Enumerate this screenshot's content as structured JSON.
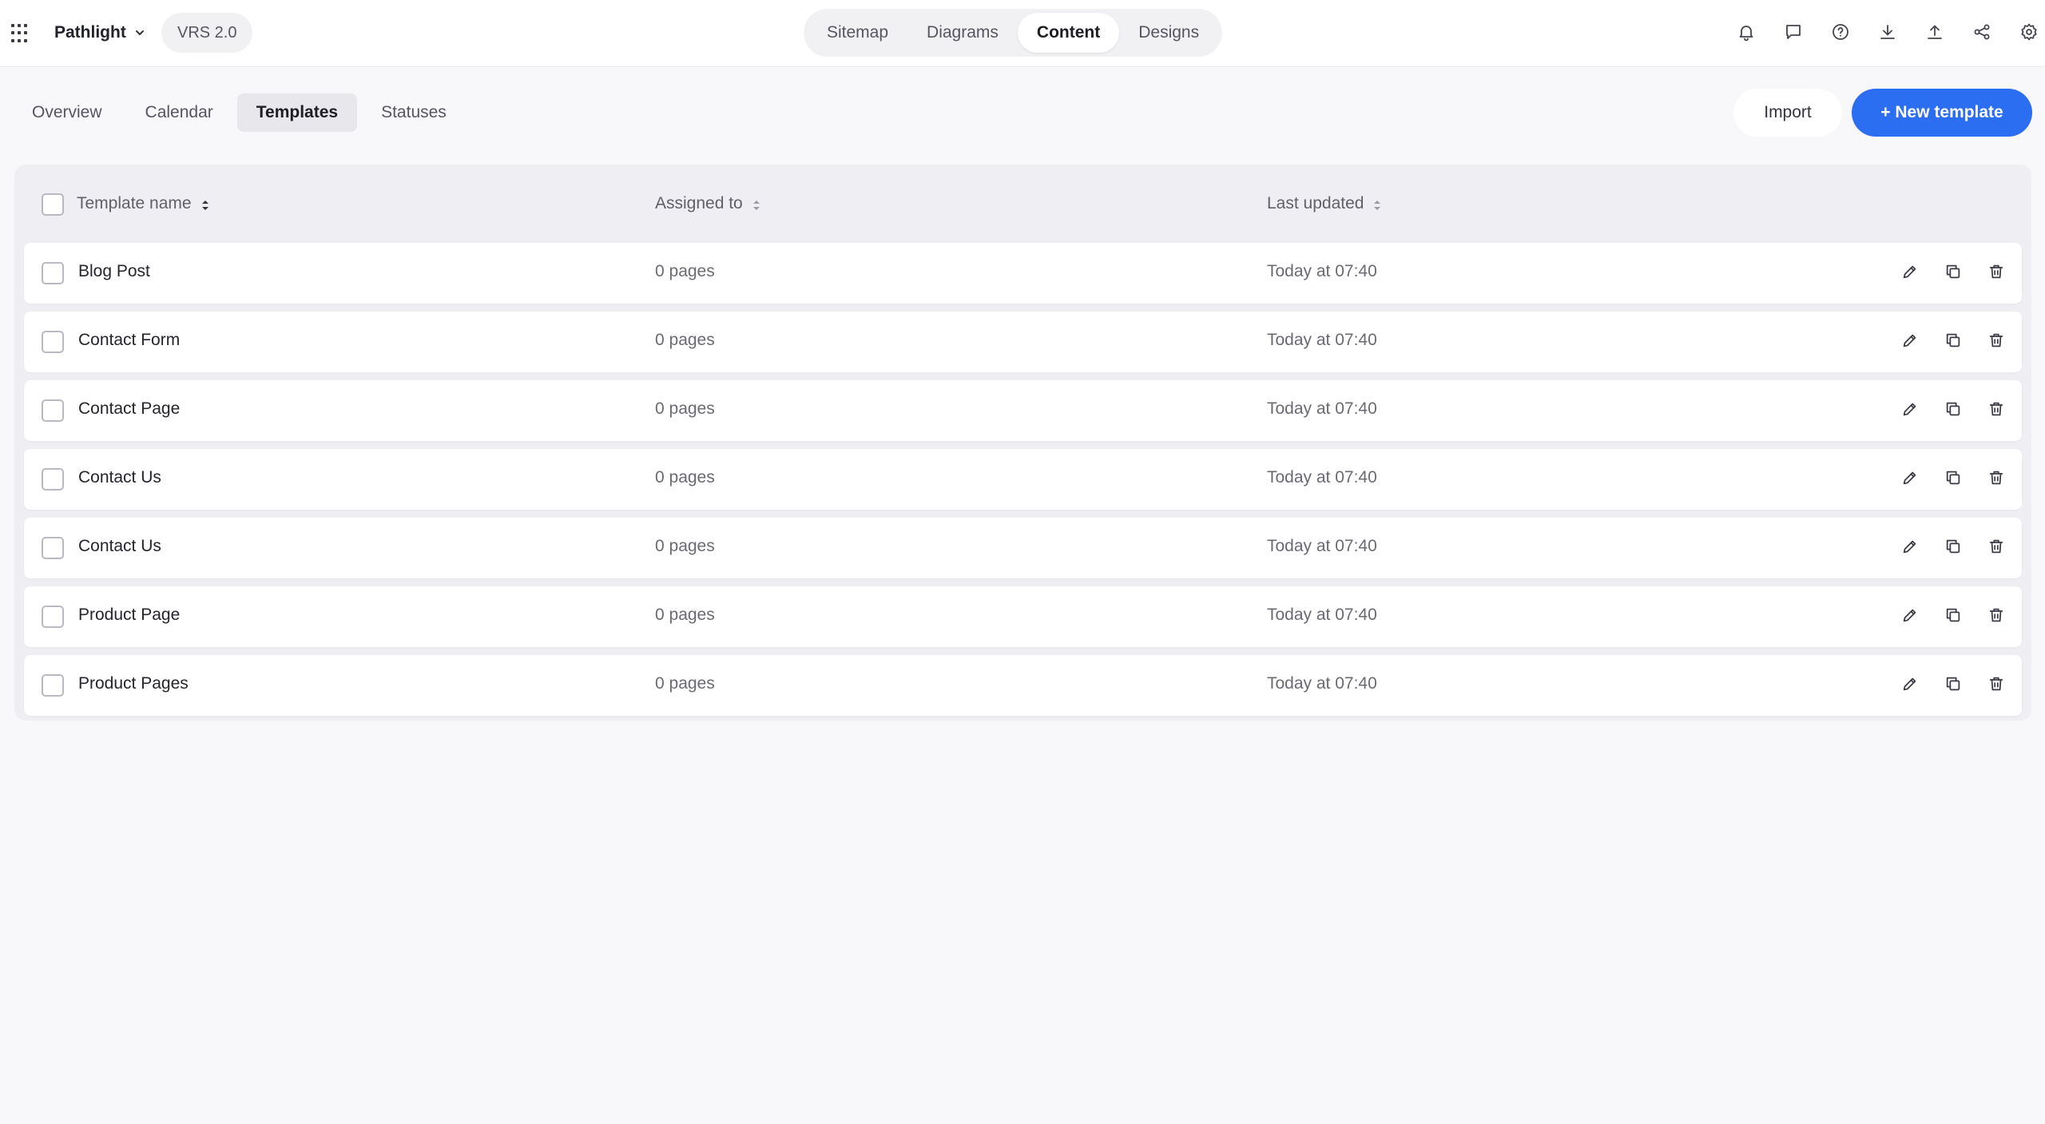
{
  "header": {
    "project_name": "Pathlight",
    "version": "VRS 2.0",
    "main_tabs": [
      {
        "label": "Sitemap",
        "active": false
      },
      {
        "label": "Diagrams",
        "active": false
      },
      {
        "label": "Content",
        "active": true
      },
      {
        "label": "Designs",
        "active": false
      }
    ],
    "icons": [
      "bell-icon",
      "comment-icon",
      "help-icon",
      "download-icon",
      "upload-icon",
      "share-icon",
      "gear-icon"
    ]
  },
  "subnav": {
    "tabs": [
      {
        "label": "Overview",
        "active": false
      },
      {
        "label": "Calendar",
        "active": false
      },
      {
        "label": "Templates",
        "active": true
      },
      {
        "label": "Statuses",
        "active": false
      }
    ],
    "import_label": "Import",
    "new_template_label": "+ New template"
  },
  "table": {
    "columns": {
      "name": "Template name",
      "assigned": "Assigned to",
      "updated": "Last updated"
    },
    "rows": [
      {
        "name": "Blog Post",
        "assigned": "0 pages",
        "updated": "Today at 07:40"
      },
      {
        "name": "Contact Form",
        "assigned": "0 pages",
        "updated": "Today at 07:40"
      },
      {
        "name": "Contact Page",
        "assigned": "0 pages",
        "updated": "Today at 07:40"
      },
      {
        "name": "Contact Us",
        "assigned": "0 pages",
        "updated": "Today at 07:40"
      },
      {
        "name": "Contact Us",
        "assigned": "0 pages",
        "updated": "Today at 07:40"
      },
      {
        "name": "Product Page",
        "assigned": "0 pages",
        "updated": "Today at 07:40"
      },
      {
        "name": "Product Pages",
        "assigned": "0 pages",
        "updated": "Today at 07:40"
      }
    ],
    "row_actions": [
      "edit-icon",
      "duplicate-icon",
      "trash-icon"
    ]
  },
  "colors": {
    "accent": "#2b6ef2",
    "background": "#f8f8fa",
    "table_bg": "#efeff3"
  }
}
